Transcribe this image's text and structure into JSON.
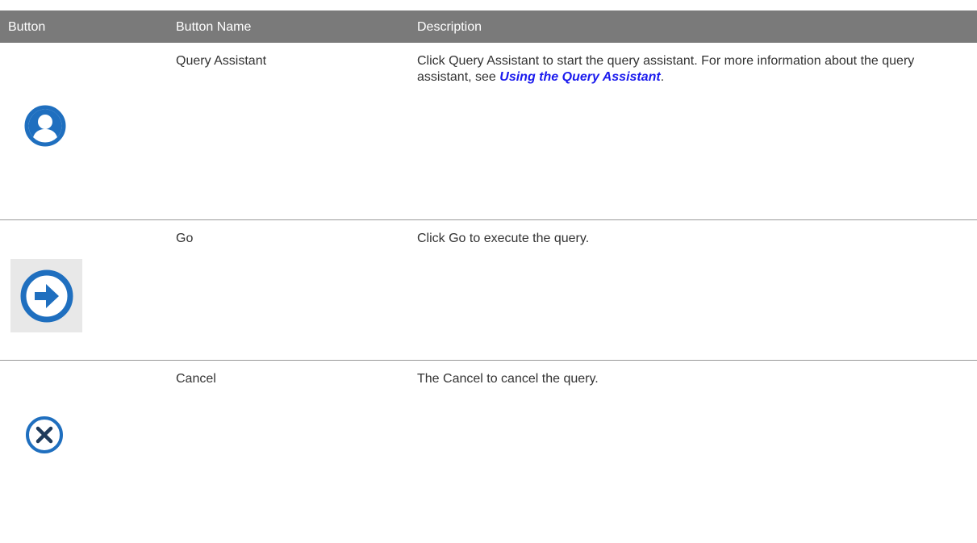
{
  "table": {
    "headers": [
      "Button",
      "Button Name",
      "Description"
    ],
    "rows": [
      {
        "icon": "user-assistant-icon",
        "name": "Query Assistant",
        "desc_prefix": "Click Query Assistant to start the query assistant. For more information about the query assistant, see ",
        "desc_link": "Using the Query Assistant",
        "desc_suffix": "."
      },
      {
        "icon": "arrow-right-circle-icon",
        "name": "Go",
        "desc": "Click Go to execute the query."
      },
      {
        "icon": "close-circle-icon",
        "name": "Cancel",
        "desc": "The Cancel to cancel the query."
      }
    ]
  },
  "colors": {
    "header_bg": "#7a7a7a",
    "icon_blue": "#1f6fbf",
    "link": "#1a1aee"
  }
}
